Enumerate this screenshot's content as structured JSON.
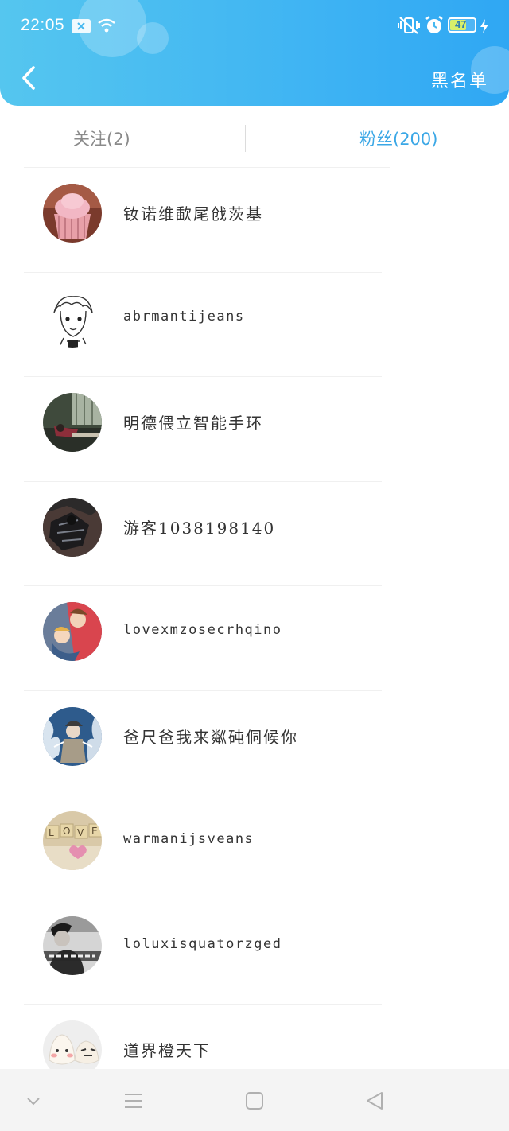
{
  "status": {
    "time": "22:05",
    "battery": "47"
  },
  "header": {
    "back_icon": "chevron-left-icon",
    "blacklist_label": "黑名单"
  },
  "tabs": [
    {
      "label": "关注(2)",
      "active": false
    },
    {
      "label": "粉丝(200)",
      "active": true
    }
  ],
  "colors": {
    "header": "#3fb4f3",
    "active_tab": "#3aa7e6",
    "inactive_tab": "#8a8a8a"
  },
  "users": [
    {
      "name": "钕诺维歃尾戗茨基",
      "avatar": "cupcake-avatar"
    },
    {
      "name": "abrmantijeans",
      "avatar": "sketch-boy-avatar"
    },
    {
      "name": "明德偎立智能手环",
      "avatar": "classroom-avatar"
    },
    {
      "name": "游客1038198140",
      "avatar": "dark-figure-avatar"
    },
    {
      "name": "lovexmzosecrhqino",
      "avatar": "cartoon-couple-avatar"
    },
    {
      "name": "爸尺爸我来粼砘侗候你",
      "avatar": "anime-blue-avatar"
    },
    {
      "name": "warmanijsveans",
      "avatar": "love-tiles-avatar"
    },
    {
      "name": "loluxisquatorzged",
      "avatar": "bw-photo-avatar"
    },
    {
      "name": "道界橙天下",
      "avatar": "rice-ball-avatar"
    }
  ],
  "nav": [
    "chevron-down-icon",
    "menu-icon",
    "home-square-icon",
    "back-triangle-icon"
  ]
}
